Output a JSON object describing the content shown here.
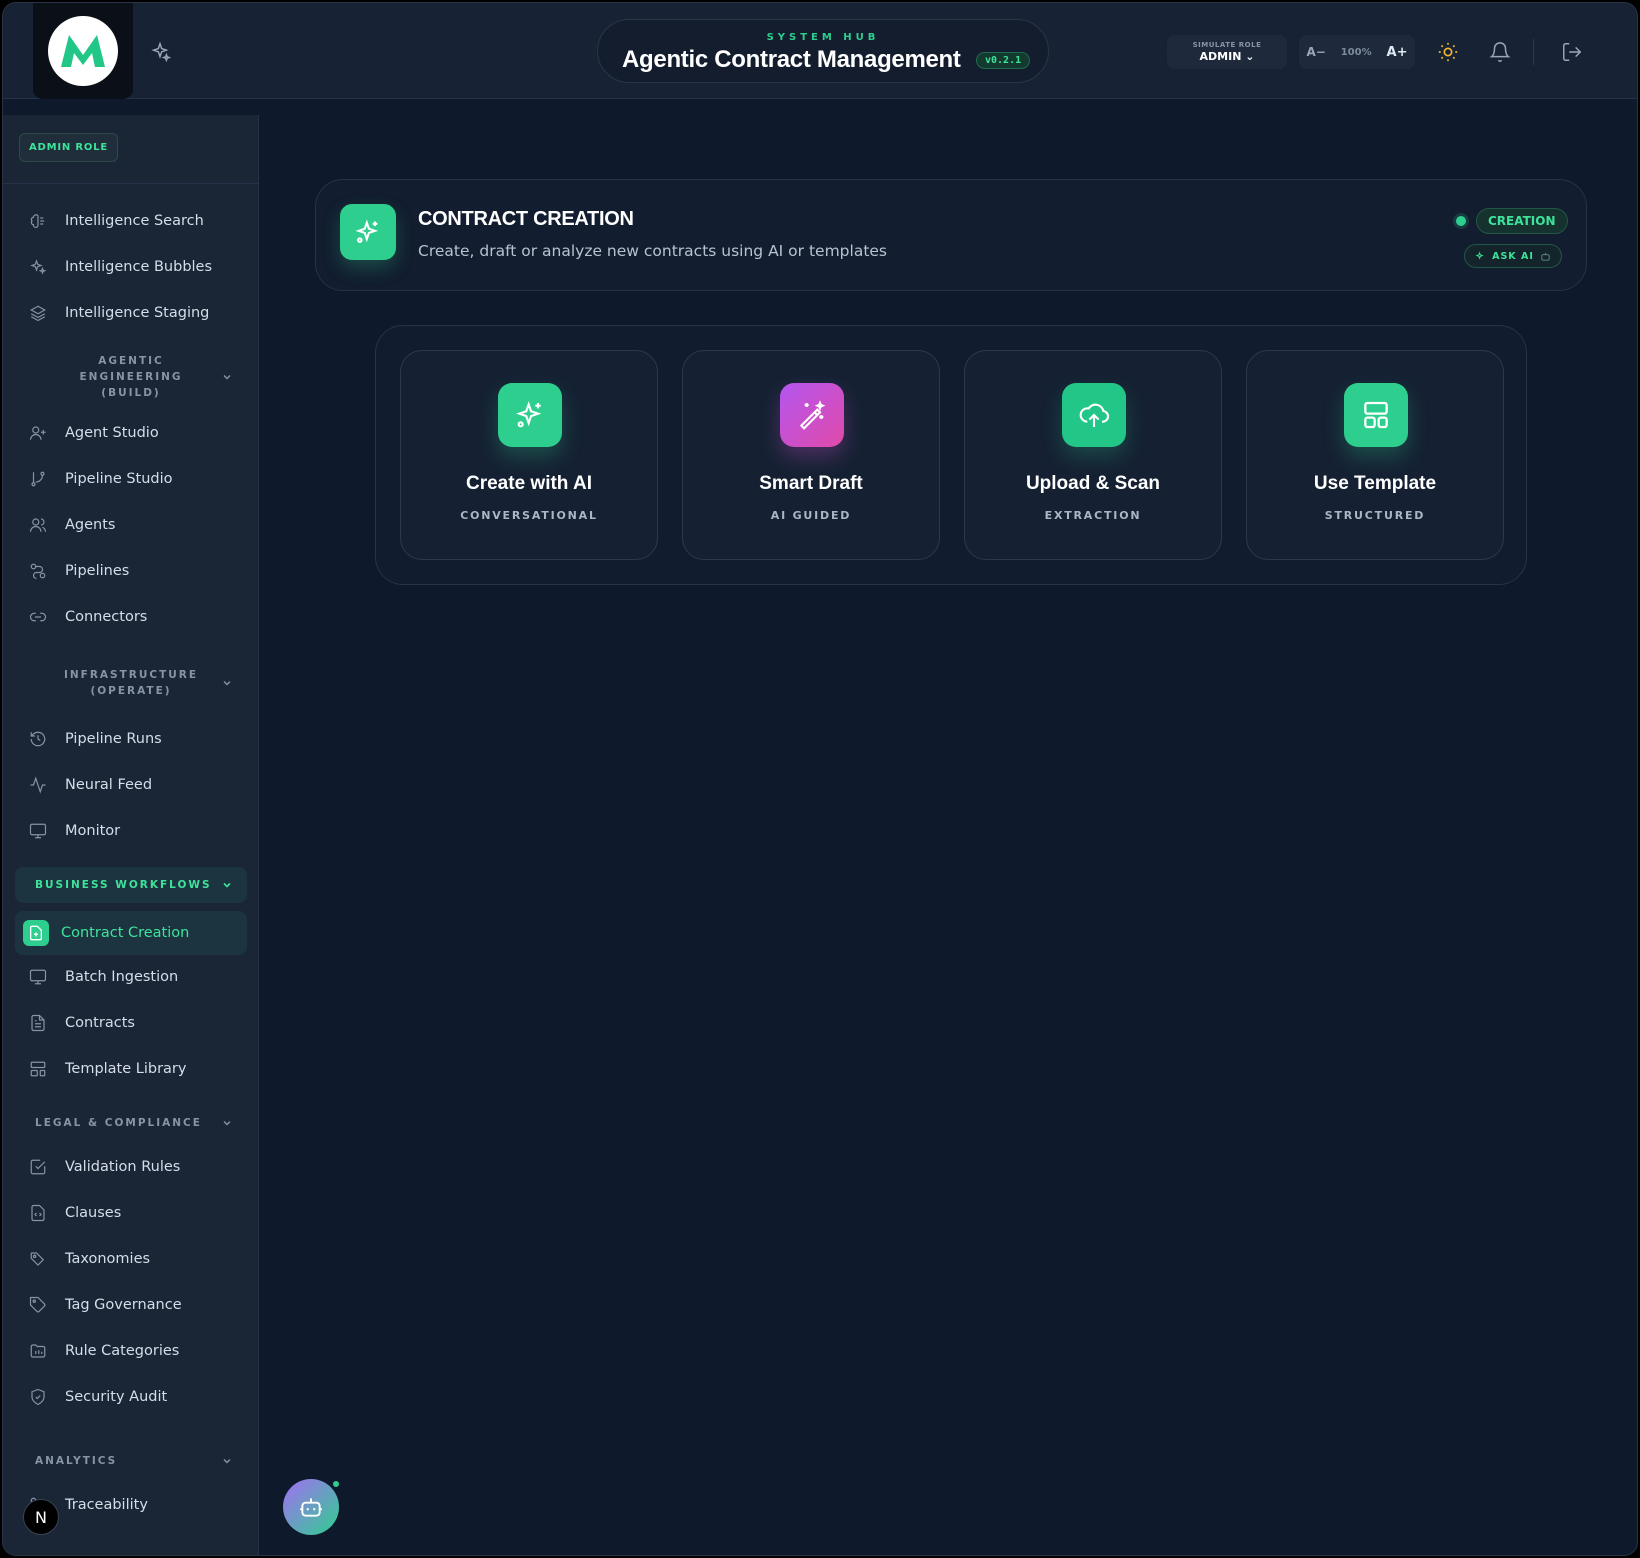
{
  "header": {
    "hub_label": "SYSTEM HUB",
    "title": "Agentic Contract Management",
    "version": "v0.2.1",
    "simulate_role_label": "SIMULATE ROLE",
    "simulate_role_value": "ADMIN",
    "font_decrease": "A−",
    "font_zoom": "100%",
    "font_increase": "A+"
  },
  "sidebar": {
    "role_badge": "ADMIN ROLE",
    "top_items": [
      {
        "label": "Intelligence Search",
        "icon": "brain-icon"
      },
      {
        "label": "Intelligence Bubbles",
        "icon": "sparkles-icon"
      },
      {
        "label": "Intelligence Staging",
        "icon": "layers-icon"
      }
    ],
    "sections": {
      "agentic": "AGENTIC ENGINEERING (BUILD)",
      "infrastructure": "INFRASTRUCTURE (OPERATE)",
      "business": "BUSINESS WORKFLOWS",
      "legal": "LEGAL & COMPLIANCE",
      "analytics": "ANALYTICS"
    },
    "agentic_items": [
      {
        "label": "Agent Studio",
        "icon": "user-plus-icon"
      },
      {
        "label": "Pipeline Studio",
        "icon": "git-branch-icon"
      },
      {
        "label": "Agents",
        "icon": "users-icon"
      },
      {
        "label": "Pipelines",
        "icon": "route-icon"
      },
      {
        "label": "Connectors",
        "icon": "link-icon"
      }
    ],
    "infrastructure_items": [
      {
        "label": "Pipeline Runs",
        "icon": "history-icon"
      },
      {
        "label": "Neural Feed",
        "icon": "activity-icon"
      },
      {
        "label": "Monitor",
        "icon": "monitor-icon"
      }
    ],
    "business_items": [
      {
        "label": "Contract Creation",
        "icon": "file-plus-icon",
        "active": true
      },
      {
        "label": "Batch Ingestion",
        "icon": "monitor-icon"
      },
      {
        "label": "Contracts",
        "icon": "file-text-icon"
      },
      {
        "label": "Template Library",
        "icon": "layout-icon"
      }
    ],
    "legal_items": [
      {
        "label": "Validation Rules",
        "icon": "check-square-icon"
      },
      {
        "label": "Clauses",
        "icon": "file-code-icon"
      },
      {
        "label": "Taxonomies",
        "icon": "tags-icon"
      },
      {
        "label": "Tag Governance",
        "icon": "tag-icon"
      },
      {
        "label": "Rule Categories",
        "icon": "folder-icon"
      },
      {
        "label": "Security Audit",
        "icon": "shield-check-icon"
      }
    ],
    "analytics_items": [
      {
        "label": "Traceability",
        "icon": "trace-icon"
      }
    ],
    "user_initial": "N"
  },
  "banner": {
    "title": "CONTRACT CREATION",
    "subtitle": "Create, draft or analyze new contracts using AI or templates",
    "status_badge": "CREATION",
    "ask_ai": "ASK AI"
  },
  "cards": [
    {
      "title": "Create with AI",
      "subtitle": "CONVERSATIONAL",
      "icon": "sparkles-icon",
      "color": "#2ecf8e"
    },
    {
      "title": "Smart Draft",
      "subtitle": "AI GUIDED",
      "icon": "magic-wand-icon",
      "color": "#c84fd0"
    },
    {
      "title": "Upload & Scan",
      "subtitle": "EXTRACTION",
      "icon": "cloud-upload-icon",
      "color": "#22c686"
    },
    {
      "title": "Use Template",
      "subtitle": "STRUCTURED",
      "icon": "layout-template-icon",
      "color": "#2ecf8e"
    }
  ],
  "colors": {
    "accent": "#2ecf8e",
    "background": "#0e1a2c",
    "sidebar": "#1a2536"
  }
}
